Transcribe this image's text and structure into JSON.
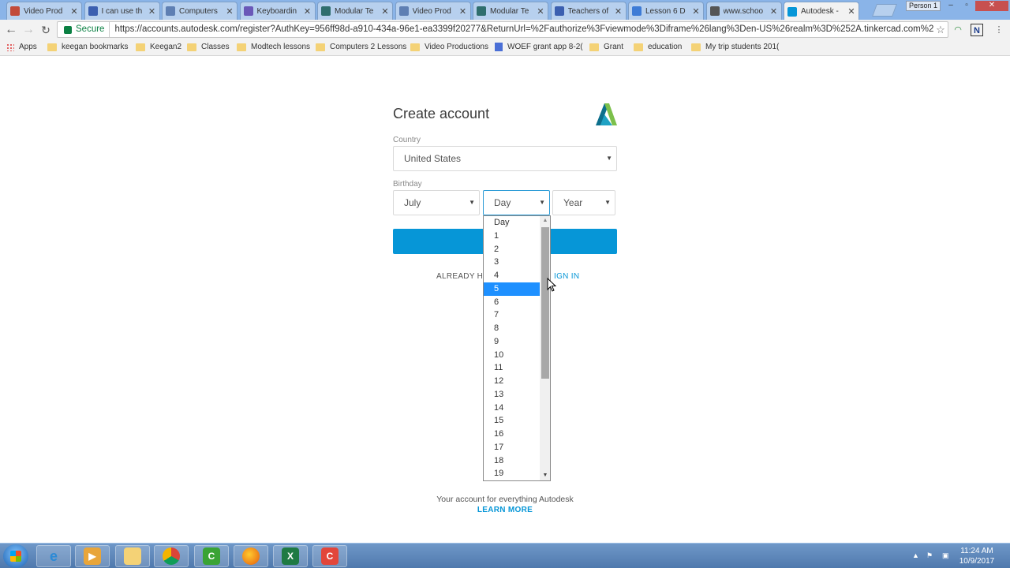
{
  "browser": {
    "tabs": [
      {
        "title": "Video Prod",
        "color": "#c24a3a"
      },
      {
        "title": "I can use th",
        "color": "#3b5fb0"
      },
      {
        "title": "Computers",
        "color": "#5e7fb3"
      },
      {
        "title": "Keyboardin",
        "color": "#6a58b8"
      },
      {
        "title": "Modular Te",
        "color": "#2f6e6e"
      },
      {
        "title": "Video Prod",
        "color": "#5e7fb3"
      },
      {
        "title": "Modular Te",
        "color": "#2f6e6e"
      },
      {
        "title": "Teachers of",
        "color": "#3b5fb0"
      },
      {
        "title": "Lesson 6 D",
        "color": "#3d7bd6"
      },
      {
        "title": "www.schoo",
        "color": "#555555"
      },
      {
        "title": "Autodesk -",
        "color": "#0696d7"
      }
    ],
    "profile": "Person 1",
    "secure_label": "Secure",
    "url": "https://accounts.autodesk.com/register?AuthKey=956ff98d-a910-434a-96e1-ea3399f20277&ReturnUrl=%2Fauthorize%3Fviewmode%3Diframe%26lang%3Den-US%26realm%3D%252A.tinkercad.com%26ctx...",
    "bookmarks": [
      "Apps",
      "keegan bookmarks",
      "Keegan2",
      "Classes",
      "Modtech lessons",
      "Computers 2 Lessons",
      "Video Productions",
      "WOEF grant app 8-2(",
      "Grant",
      "education",
      "My trip students 201("
    ]
  },
  "form": {
    "title": "Create account",
    "country_label": "Country",
    "country_value": "United States",
    "birthday_label": "Birthday",
    "month_value": "July",
    "day_value": "Day",
    "year_value": "Year",
    "already_text": "ALREADY HAV",
    "signin_text": "IGN IN",
    "footer_text": "Your account for everything Autodesk",
    "learn_more": "LEARN MORE"
  },
  "day_dropdown": {
    "options": [
      "Day",
      "1",
      "2",
      "3",
      "4",
      "5",
      "6",
      "7",
      "8",
      "9",
      "10",
      "11",
      "12",
      "13",
      "14",
      "15",
      "16",
      "17",
      "18",
      "19"
    ],
    "selected": "5"
  },
  "taskbar": {
    "time": "11:24 AM",
    "date": "10/9/2017",
    "apps": [
      "internet-explorer",
      "media-player",
      "file-explorer",
      "chrome",
      "camtasia",
      "firefox",
      "excel",
      "camtasia-recorder"
    ]
  },
  "colors": {
    "accent": "#0696d7",
    "selected_option": "#1e90ff"
  }
}
